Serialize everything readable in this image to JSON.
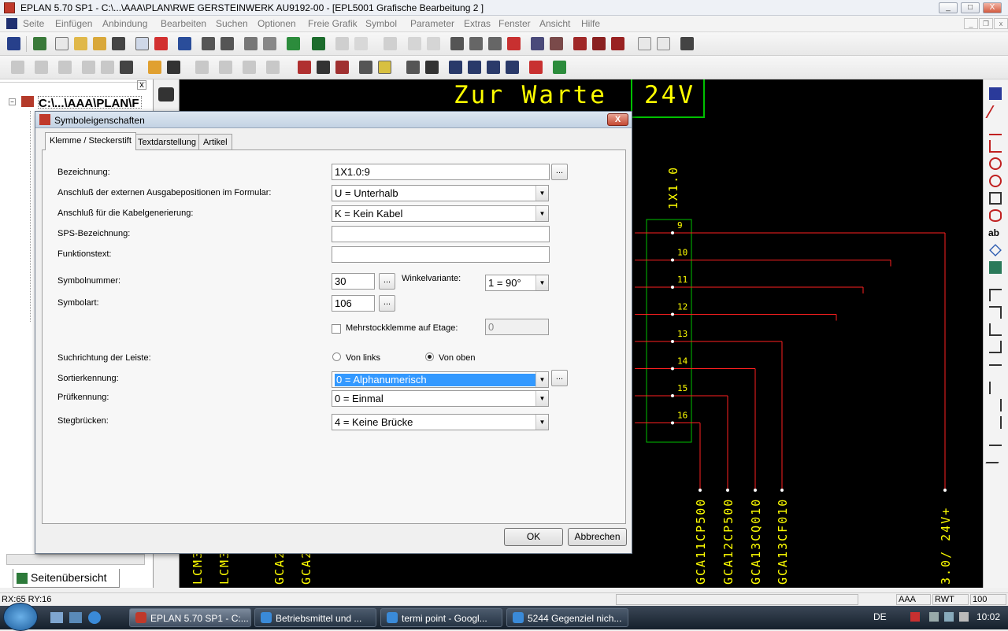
{
  "window": {
    "title": "EPLAN 5.70 SP1 - C:\\...\\AAA\\PLAN\\RWE GERSTEINWERK AU9192-00 - [EPL5001 Grafische Bearbeitung 2 ]",
    "minimize": "_",
    "maximize": "□",
    "close": "X"
  },
  "menu": [
    "Seite",
    "Einfügen",
    "Anbindung",
    "Bearbeiten",
    "Suchen",
    "Optionen",
    "Freie Grafik",
    "Symbol",
    "Parameter",
    "Extras",
    "Fenster",
    "Ansicht",
    "Hilfe"
  ],
  "mdi": {
    "minimize": "_",
    "restore": "❐",
    "close": "x"
  },
  "tree": {
    "root": "C:\\...\\AAA\\PLAN\\F",
    "footer_tab": "Seitenübersicht",
    "pane_close": "x"
  },
  "canvas": {
    "title_left": "Zur Warte",
    "title_right": "24V",
    "strip_label": "1X1.0",
    "terminals": [
      "9",
      "10",
      "11",
      "12",
      "13",
      "14",
      "15",
      "16"
    ],
    "cable_labels": [
      "GCA11CP500",
      "GCA12CP500",
      "GCA13CQ010",
      "GCA13CF010",
      "3.0/ 24V+"
    ],
    "left_labels": [
      "LCM3",
      "LCM3",
      "GCA2",
      "GCA2"
    ],
    "colors": {
      "text": "#ffff00",
      "wire": "#ff2020",
      "strip": "#00c000",
      "background": "#000000"
    }
  },
  "dialog": {
    "title": "Symboleigenschaften",
    "close": "X",
    "tabs": [
      "Klemme / Steckerstift",
      "Textdarstellung",
      "Artikel"
    ],
    "labels": {
      "bezeichnung": "Bezeichnung:",
      "anschluss_formular": "Anschluß der externen Ausgabepositionen im Formular:",
      "anschluss_kabel": "Anschluß für die Kabelgenerierung:",
      "sps": "SPS-Bezeichnung:",
      "funktionstext": "Funktionstext:",
      "symbolnummer": "Symbolnummer:",
      "winkelvariante": "Winkelvariante:",
      "symbolart": "Symbolart:",
      "mehrstock": "Mehrstockklemme auf Etage:",
      "suchrichtung": "Suchrichtung der Leiste:",
      "von_links": "Von links",
      "von_oben": "Von oben",
      "sortierkennung": "Sortierkennung:",
      "pruefkennung": "Prüfkennung:",
      "stegbruecken": "Stegbrücken:"
    },
    "values": {
      "bezeichnung": "1X1.0:9",
      "anschluss_formular": "U = Unterhalb",
      "anschluss_kabel": "K = Kein Kabel",
      "sps": "",
      "funktionstext": "",
      "symbolnummer": "30",
      "winkelvariante": "1 = 90°",
      "symbolart": "106",
      "mehrstock": "0",
      "sortierkennung": "0 = Alphanumerisch",
      "pruefkennung": "0 = Einmal",
      "stegbruecken": "4 = Keine Brücke"
    },
    "browse": "...",
    "ok": "OK",
    "cancel": "Abbrechen"
  },
  "status": {
    "coords": "RX:65 RY:16",
    "f1": "AAA",
    "f2": "RWT",
    "f3": "100"
  },
  "taskbar": {
    "tasks": [
      "EPLAN 5.70 SP1 - C:...",
      "Betriebsmittel und ...",
      "termi point - Googl...",
      "5244 Gegenziel nich..."
    ],
    "lang": "DE",
    "clock": "10:02"
  }
}
